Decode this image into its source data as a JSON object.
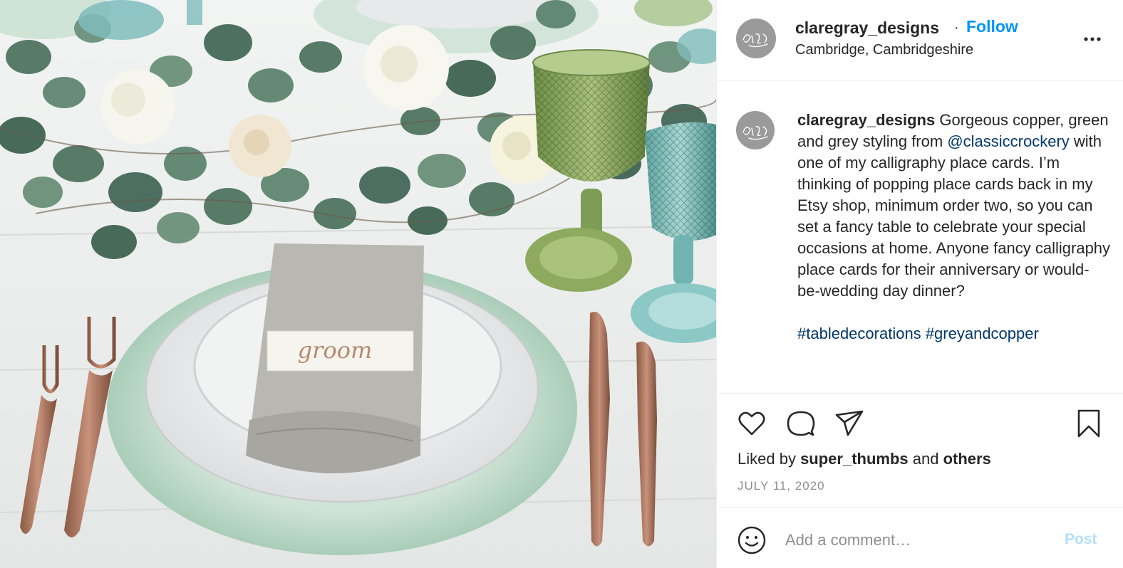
{
  "post": {
    "username": "claregray_designs",
    "separator": "·",
    "follow_label": "Follow",
    "location": "Cambridge, Cambridgeshire",
    "more_icon": "ellipsis-icon",
    "avatar_lettering": "Clare Gray"
  },
  "photo": {
    "place_card_text": "groom"
  },
  "caption": {
    "username": "claregray_designs",
    "text_1": " Gorgeous copper, green and grey styling from ",
    "mention": "@classiccrockery",
    "text_2": " with one of my calligraphy place cards. I’m thinking of popping place cards back in my Etsy shop, minimum order two, so you can set a fancy table to celebrate your special occasions at home. Anyone fancy calligraphy place cards for their anniversary or would-be-wedding day dinner?",
    "hashtag_1": "#tabledecorations",
    "hashtag_2": "#greyandcopper"
  },
  "actions": {
    "icons": [
      "heart-icon",
      "comment-icon",
      "share-icon",
      "bookmark-icon"
    ],
    "liked_by_prefix": "Liked by ",
    "liked_by_user": "super_thumbs",
    "liked_by_and": " and ",
    "liked_by_others": "others",
    "date": "JULY 11, 2020"
  },
  "comment": {
    "placeholder": "Add a comment…",
    "post_label": "Post"
  },
  "colors": {
    "accent": "#0095f6",
    "link": "#00376b",
    "post_disabled": "#b2dffc",
    "muted": "#8e8e8e"
  }
}
